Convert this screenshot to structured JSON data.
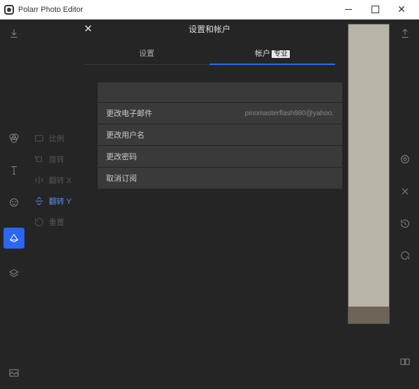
{
  "window": {
    "title": "Polarr Photo Editor"
  },
  "dialog": {
    "title": "设置和帐户",
    "close_glyph": "✕",
    "tabs": [
      {
        "label": "设置",
        "badge": ""
      },
      {
        "label": "帐户",
        "badge": "专业"
      }
    ],
    "account": {
      "rows": [
        {
          "label": "更改电子邮件",
          "value": "pinomasterflash980@yahoo."
        },
        {
          "label": "更改用户名",
          "value": ""
        },
        {
          "label": "更改密码",
          "value": ""
        },
        {
          "label": "取消订阅",
          "value": ""
        }
      ]
    }
  },
  "tools": {
    "items": [
      {
        "label": "比例"
      },
      {
        "label": "旋转"
      },
      {
        "label": "翻转 X"
      },
      {
        "label": "翻转 Y"
      },
      {
        "label": "重置"
      }
    ]
  }
}
